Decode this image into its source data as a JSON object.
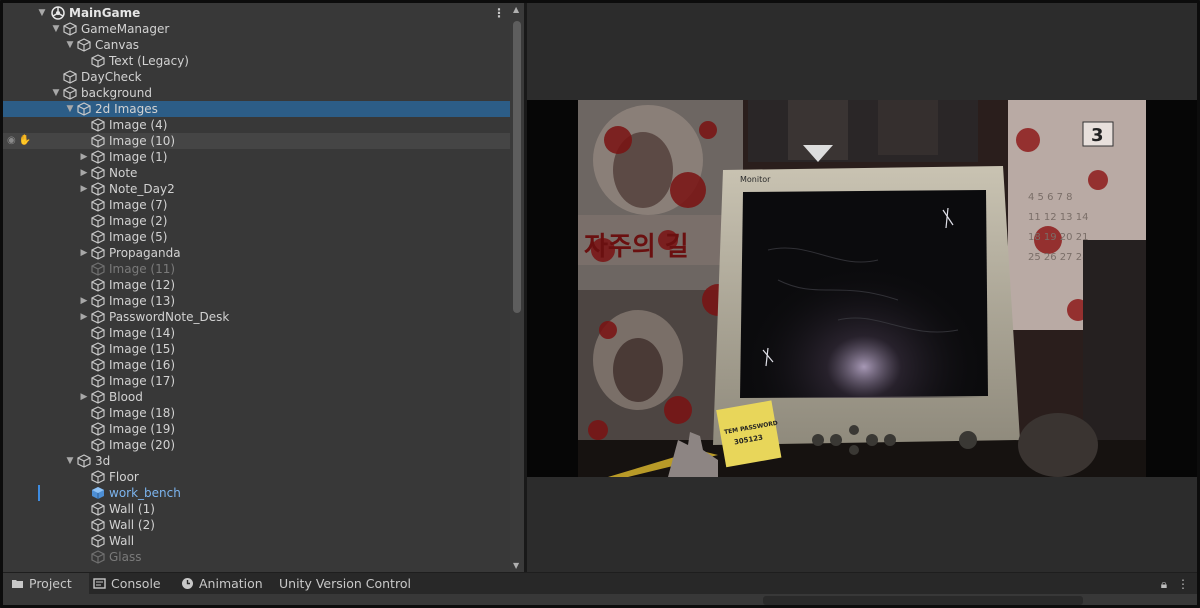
{
  "hierarchy": {
    "root": "MainGame",
    "items": [
      {
        "label": "GameManager",
        "level": 1,
        "arrow": "down"
      },
      {
        "label": "Canvas",
        "level": 2,
        "arrow": "down"
      },
      {
        "label": "Text (Legacy)",
        "level": 3,
        "arrow": "none"
      },
      {
        "label": "DayCheck",
        "level": 1,
        "arrow": "none"
      },
      {
        "label": "background",
        "level": 1,
        "arrow": "down"
      },
      {
        "label": "2d Images",
        "level": 2,
        "arrow": "down",
        "selected": true
      },
      {
        "label": "Image (4)",
        "level": 3,
        "arrow": "none"
      },
      {
        "label": "Image (10)",
        "level": 3,
        "arrow": "none",
        "hover": true
      },
      {
        "label": "Image (1)",
        "level": 3,
        "arrow": "right"
      },
      {
        "label": "Note",
        "level": 3,
        "arrow": "right"
      },
      {
        "label": "Note_Day2",
        "level": 3,
        "arrow": "right"
      },
      {
        "label": "Image (7)",
        "level": 3,
        "arrow": "none"
      },
      {
        "label": "Image (2)",
        "level": 3,
        "arrow": "none"
      },
      {
        "label": "Image (5)",
        "level": 3,
        "arrow": "none"
      },
      {
        "label": "Propaganda",
        "level": 3,
        "arrow": "right"
      },
      {
        "label": "Image (11)",
        "level": 3,
        "arrow": "none",
        "dim": true
      },
      {
        "label": "Image (12)",
        "level": 3,
        "arrow": "none"
      },
      {
        "label": "Image (13)",
        "level": 3,
        "arrow": "right"
      },
      {
        "label": "PasswordNote_Desk",
        "level": 3,
        "arrow": "right"
      },
      {
        "label": "Image (14)",
        "level": 3,
        "arrow": "none"
      },
      {
        "label": "Image (15)",
        "level": 3,
        "arrow": "none"
      },
      {
        "label": "Image (16)",
        "level": 3,
        "arrow": "none"
      },
      {
        "label": "Image (17)",
        "level": 3,
        "arrow": "none"
      },
      {
        "label": "Blood",
        "level": 3,
        "arrow": "right"
      },
      {
        "label": "Image (18)",
        "level": 3,
        "arrow": "none"
      },
      {
        "label": "Image (19)",
        "level": 3,
        "arrow": "none"
      },
      {
        "label": "Image (20)",
        "level": 3,
        "arrow": "none"
      },
      {
        "label": "3d",
        "level": 2,
        "arrow": "down"
      },
      {
        "label": "Floor",
        "level": 3,
        "arrow": "none"
      },
      {
        "label": "work_bench",
        "level": 3,
        "arrow": "none",
        "prefab": true
      },
      {
        "label": "Wall (1)",
        "level": 3,
        "arrow": "none"
      },
      {
        "label": "Wall (2)",
        "level": 3,
        "arrow": "none"
      },
      {
        "label": "Wall",
        "level": 3,
        "arrow": "none"
      },
      {
        "label": "Glass",
        "level": 3,
        "arrow": "none",
        "dim": true
      }
    ]
  },
  "tabs": [
    {
      "label": "Project",
      "icon": "folder-icon",
      "active": true
    },
    {
      "label": "Console",
      "icon": "console-icon",
      "active": false
    },
    {
      "label": "Animation",
      "icon": "animation-clock-icon",
      "active": false
    },
    {
      "label": "Unity Version Control",
      "icon": "none",
      "active": false
    }
  ],
  "game": {
    "monitor_label": "Monitor",
    "sticky_line1": "TEM PASSWORD",
    "sticky_line2": "305123",
    "calendar_number": "3"
  },
  "colors": {
    "selected_row": "#2c5d87",
    "prefab_text": "#7cb4ee",
    "panel_bg": "#383838"
  }
}
